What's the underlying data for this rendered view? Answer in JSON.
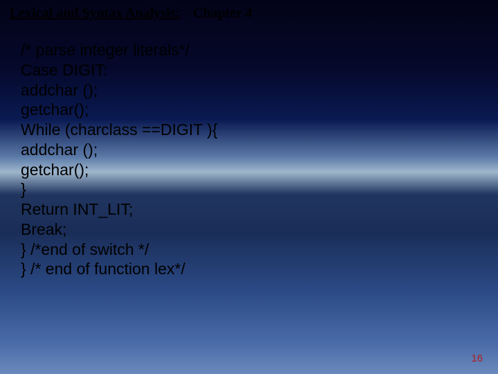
{
  "header": {
    "section": "Lexical and Syntax Analysis:",
    "chapter": "Chapter 4"
  },
  "code": {
    "l1": "/* parse integer literals*/",
    "l2": "Case DIGIT:",
    "l3": "addchar ();",
    "l4": "getchar();",
    "l5": "While (charclass ==DIGIT ){",
    "l6": "addchar ();",
    "l7": "getchar();",
    "l8": "}",
    "l9": "Return INT_LIT;",
    "l10": "Break;",
    "l11": "} /*end of switch */",
    "l12": "} /* end of function lex*/"
  },
  "page_number": "16"
}
